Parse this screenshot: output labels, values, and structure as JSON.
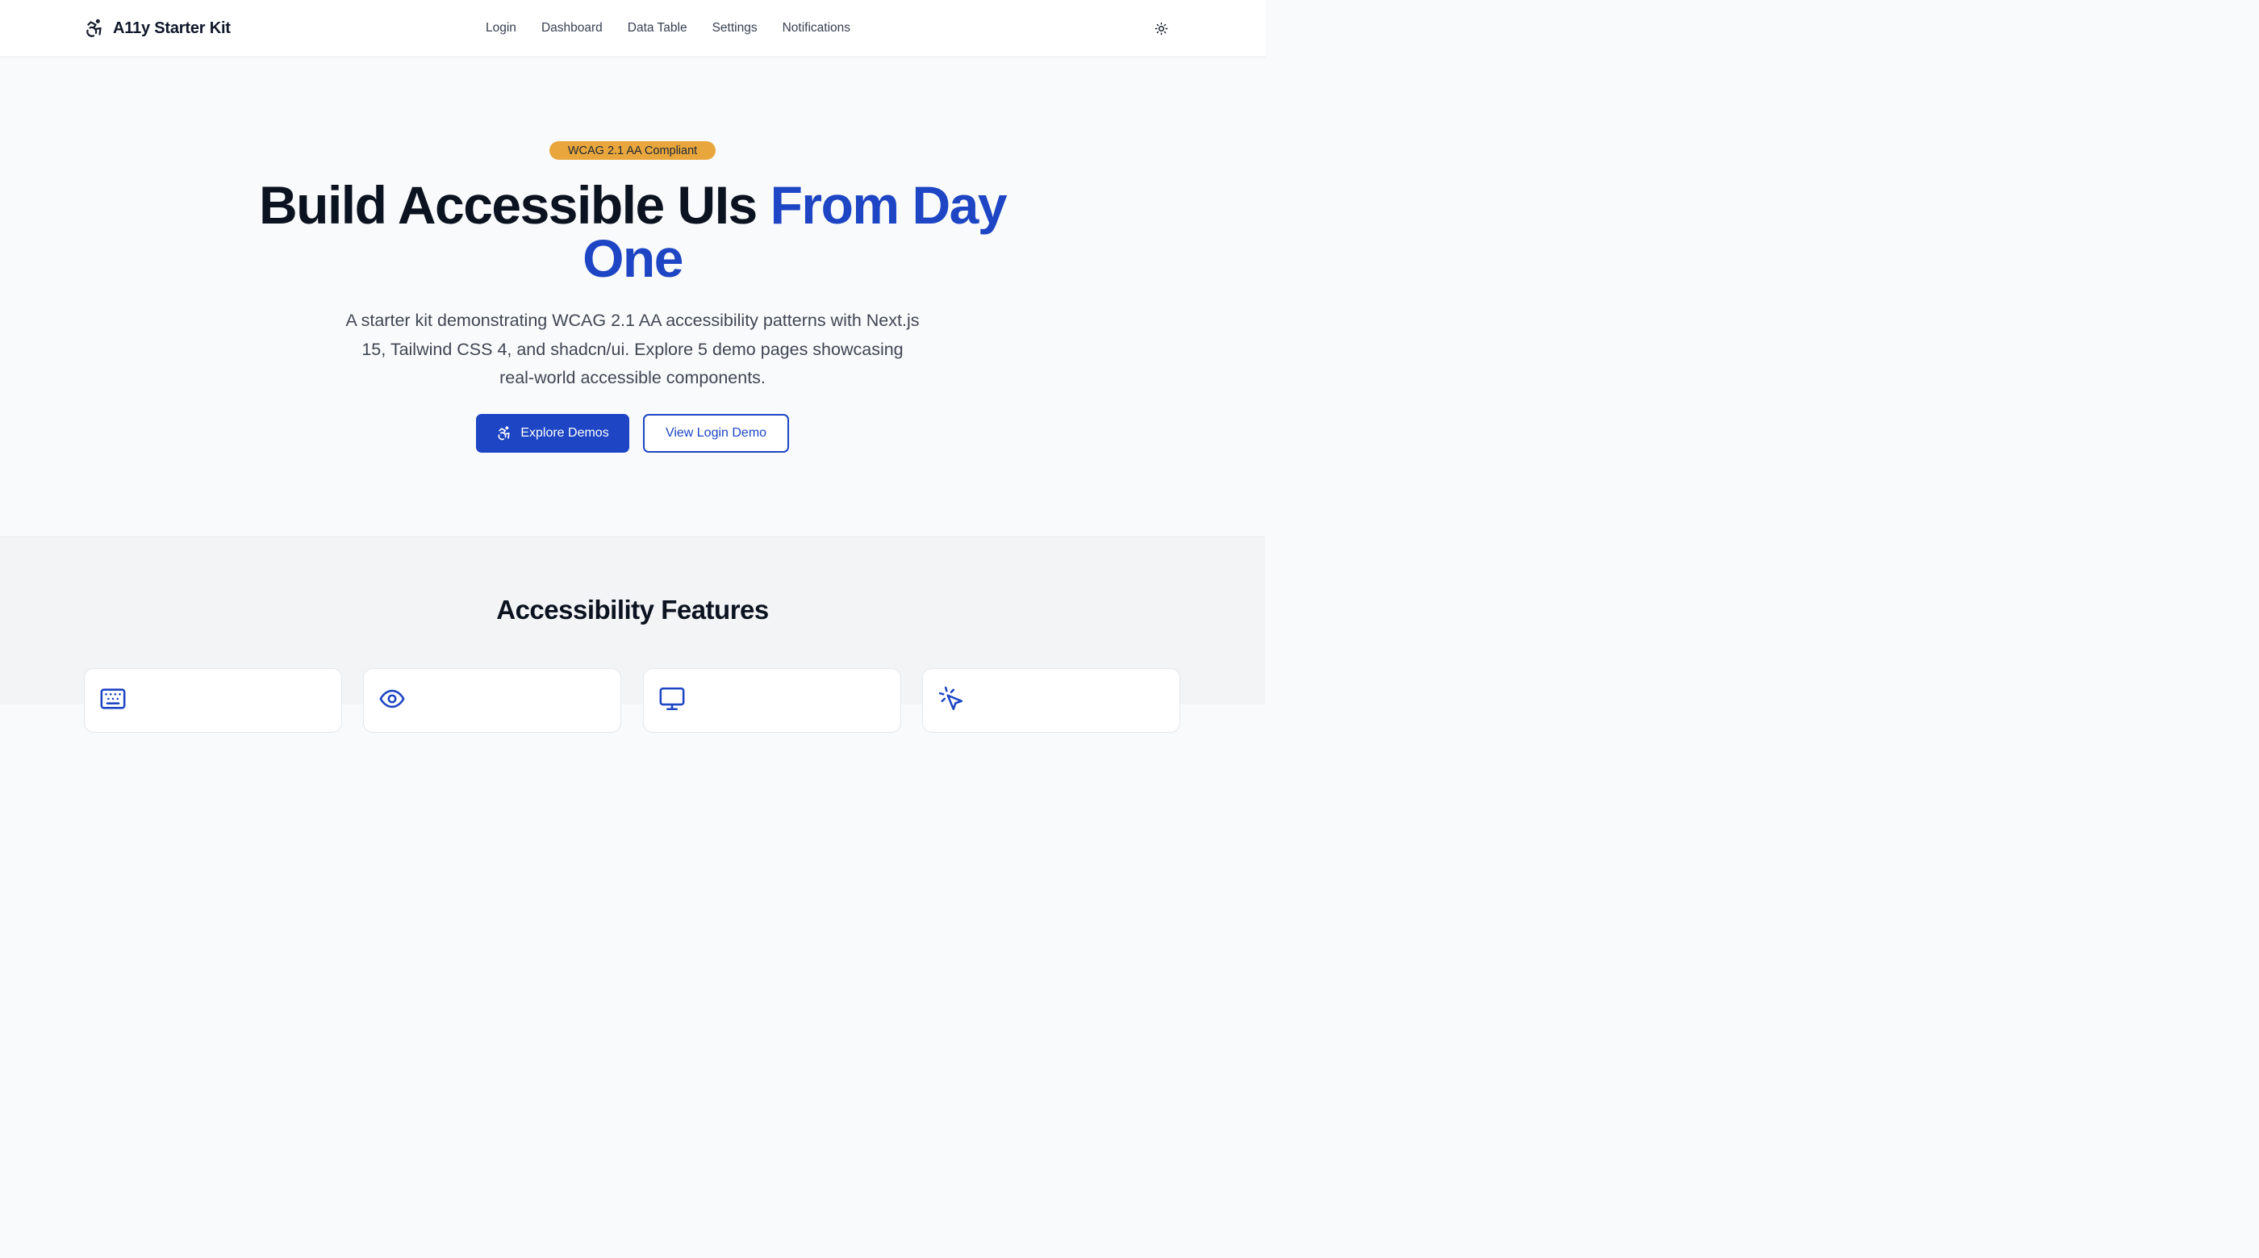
{
  "header": {
    "brand": "A11y Starter Kit",
    "brand_icon": "accessibility-icon",
    "nav": [
      "Login",
      "Dashboard",
      "Data Table",
      "Settings",
      "Notifications"
    ],
    "theme_toggle_icon": "sun-icon"
  },
  "hero": {
    "badge": "WCAG 2.1 AA Compliant",
    "title_main": "Build Accessible UIs",
    "title_accent": "From Day One",
    "description": "A starter kit demonstrating WCAG 2.1 AA accessibility patterns with Next.js 15, Tailwind CSS 4, and shadcn/ui. Explore 5 demo pages showcasing real-world accessible components.",
    "primary_button": "Explore Demos",
    "primary_button_icon": "accessibility-icon",
    "secondary_button": "View Login Demo"
  },
  "features": {
    "title": "Accessibility Features",
    "card_icons": [
      "keyboard-icon",
      "eye-icon",
      "monitor-icon",
      "pointer-click-icon"
    ]
  },
  "colors": {
    "accent": "#1d45c4",
    "badge": "#e8a63c",
    "text": "#0b1220",
    "muted_text": "#3f4653",
    "background": "#f9fafb"
  }
}
